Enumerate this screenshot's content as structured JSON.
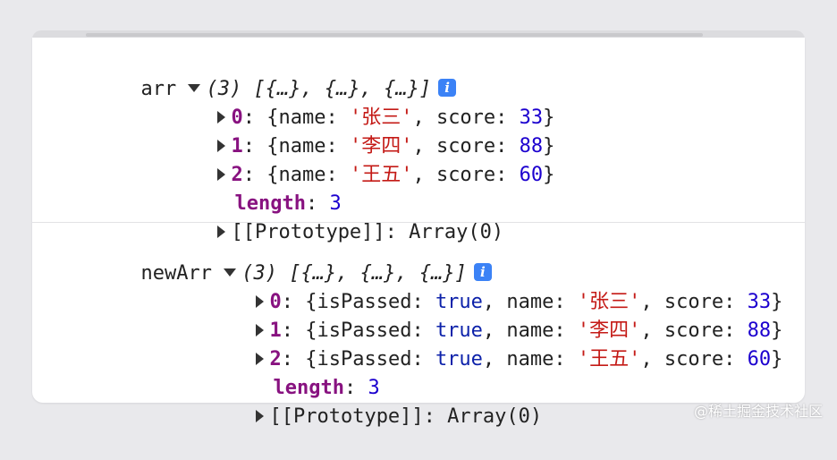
{
  "arr": {
    "name": "arr",
    "summary": "(3) [{…}, {…}, {…}]",
    "info": "i",
    "items": [
      {
        "index": "0",
        "open": "{name: ",
        "name": "'张三'",
        "mid": ", score: ",
        "score": "33",
        "close": "}"
      },
      {
        "index": "1",
        "open": "{name: ",
        "name": "'李四'",
        "mid": ", score: ",
        "score": "88",
        "close": "}"
      },
      {
        "index": "2",
        "open": "{name: ",
        "name": "'王五'",
        "mid": ", score: ",
        "score": "60",
        "close": "}"
      }
    ],
    "length_key": "length",
    "length_sep": ": ",
    "length_value": "3",
    "prototype": "[[Prototype]]: Array(0)"
  },
  "newArr": {
    "name": "newArr",
    "summary": "(3) [{…}, {…}, {…}]",
    "info": "i",
    "items": [
      {
        "index": "0",
        "open": "{isPassed: ",
        "passed": "true",
        "mid1": ", name: ",
        "name": "'张三'",
        "mid2": ", score: ",
        "score": "33",
        "close": "}"
      },
      {
        "index": "1",
        "open": "{isPassed: ",
        "passed": "true",
        "mid1": ", name: ",
        "name": "'李四'",
        "mid2": ", score: ",
        "score": "88",
        "close": "}"
      },
      {
        "index": "2",
        "open": "{isPassed: ",
        "passed": "true",
        "mid1": ", name: ",
        "name": "'王五'",
        "mid2": ", score: ",
        "score": "60",
        "close": "}"
      }
    ],
    "length_key": "length",
    "length_sep": ": ",
    "length_value": "3",
    "prototype": "[[Prototype]]: Array(0)"
  },
  "watermark": "@稀土掘金技术社区",
  "colors": {
    "index": "#881280",
    "string": "#c41a16",
    "number": "#1c00cf",
    "info": "#3b82f6"
  }
}
